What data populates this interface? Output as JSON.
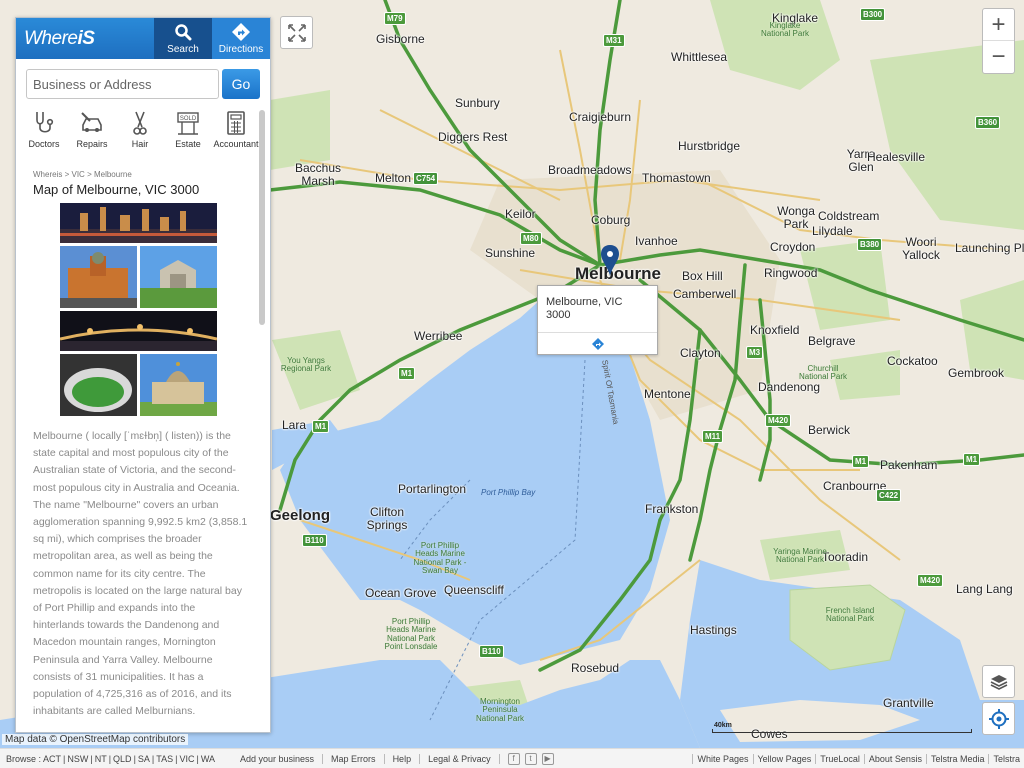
{
  "panel": {
    "logo_a": "Where",
    "logo_b": "iS",
    "search_tab": "Search",
    "directions_tab": "Directions",
    "search_placeholder": "Business or Address",
    "go_label": "Go",
    "categories": [
      {
        "label": "Doctors",
        "icon": "stethoscope-icon"
      },
      {
        "label": "Repairs",
        "icon": "car-repair-icon"
      },
      {
        "label": "Hair",
        "icon": "scissors-icon"
      },
      {
        "label": "Estate",
        "icon": "sold-sign-icon"
      },
      {
        "label": "Accountant",
        "icon": "calculator-icon"
      }
    ],
    "breadcrumb": [
      "Whereis",
      "VIC",
      "Melbourne"
    ],
    "breadcrumb_sep": ">",
    "page_title": "Map of Melbourne, VIC 3000",
    "description": "Melbourne ( locally [ˈmɛɫbn̩] ( listen)) is the state capital and most populous city of the Australian state of Victoria, and the second-most populous city in Australia and Oceania. The name \"Melbourne\" covers an urban agglomeration spanning 9,992.5 km2 (3,858.1 sq mi), which comprises the broader metropolitan area, as well as being the common name for its city centre. The metropolis is located on the large natural bay of Port Phillip and expands into the hinterlands towards the Dandenong and Macedon mountain ranges, Mornington Peninsula and Yarra Valley. Melbourne consists of 31 municipalities. It has a population of 4,725,316 as of 2016, and its inhabitants are called Melburnians."
  },
  "map": {
    "popup": "Melbourne, VIC 3000",
    "scale_label": "40km",
    "attribution": "Map data © OpenStreetMap contributors",
    "zoom_in": "+",
    "zoom_out": "−",
    "places": [
      {
        "name": "Gisborne",
        "cls": "town"
      },
      {
        "name": "Whittlesea",
        "cls": "town"
      },
      {
        "name": "Kinglake",
        "cls": "town"
      },
      {
        "name": "Sunbury",
        "cls": "town"
      },
      {
        "name": "Craigieburn",
        "cls": "town"
      },
      {
        "name": "Diggers Rest",
        "cls": "town"
      },
      {
        "name": "Hurstbridge",
        "cls": "town"
      },
      {
        "name": "Yarra Glen",
        "cls": "town"
      },
      {
        "name": "Healesville",
        "cls": "town"
      },
      {
        "name": "Bacchus Marsh",
        "cls": "town"
      },
      {
        "name": "Melton",
        "cls": "town"
      },
      {
        "name": "Broadmeadows",
        "cls": "town"
      },
      {
        "name": "Thomastown",
        "cls": "town"
      },
      {
        "name": "Keilor",
        "cls": "town"
      },
      {
        "name": "Coburg",
        "cls": "town"
      },
      {
        "name": "Wonga Park",
        "cls": "town"
      },
      {
        "name": "Coldstream",
        "cls": "town"
      },
      {
        "name": "Lilydale",
        "cls": "town"
      },
      {
        "name": "Ivanhoe",
        "cls": "town"
      },
      {
        "name": "Croydon",
        "cls": "town"
      },
      {
        "name": "Woori Yallock",
        "cls": "town"
      },
      {
        "name": "Launching Place",
        "cls": "town"
      },
      {
        "name": "Sunshine",
        "cls": "town"
      },
      {
        "name": "Melbourne",
        "cls": "city"
      },
      {
        "name": "Box Hill",
        "cls": "town"
      },
      {
        "name": "Ringwood",
        "cls": "town"
      },
      {
        "name": "Camberwell",
        "cls": "town"
      },
      {
        "name": "Knoxfield",
        "cls": "town"
      },
      {
        "name": "Werribee",
        "cls": "town"
      },
      {
        "name": "Belgrave",
        "cls": "town"
      },
      {
        "name": "Clayton",
        "cls": "town"
      },
      {
        "name": "Cockatoo",
        "cls": "town"
      },
      {
        "name": "Dandenong",
        "cls": "town"
      },
      {
        "name": "Gembrook",
        "cls": "town"
      },
      {
        "name": "Mentone",
        "cls": "town"
      },
      {
        "name": "Lara",
        "cls": "town"
      },
      {
        "name": "Berwick",
        "cls": "town"
      },
      {
        "name": "Pakenham",
        "cls": "town"
      },
      {
        "name": "Portarlington",
        "cls": "town"
      },
      {
        "name": "Cranbourne",
        "cls": "town"
      },
      {
        "name": "Geelong",
        "cls": "big"
      },
      {
        "name": "Clifton Springs",
        "cls": "town"
      },
      {
        "name": "Frankston",
        "cls": "town"
      },
      {
        "name": "Tooradin",
        "cls": "town"
      },
      {
        "name": "Ocean Grove",
        "cls": "town"
      },
      {
        "name": "Queenscliff",
        "cls": "town"
      },
      {
        "name": "Lang Lang",
        "cls": "town"
      },
      {
        "name": "Hastings",
        "cls": "town"
      },
      {
        "name": "Rosebud",
        "cls": "town"
      },
      {
        "name": "Grantville",
        "cls": "town"
      },
      {
        "name": "Cowes",
        "cls": "town"
      },
      {
        "name": "You Yangs Regional Park",
        "cls": "park"
      },
      {
        "name": "Churchill National Park",
        "cls": "park"
      },
      {
        "name": "Kinglake National Park",
        "cls": "park"
      },
      {
        "name": "Port Phillip Heads Marine National Park - Swan Bay",
        "cls": "park"
      },
      {
        "name": "Port Phillip Heads Marine National Park Point Lonsdale",
        "cls": "park"
      },
      {
        "name": "Yaringa Marine National Park",
        "cls": "park"
      },
      {
        "name": "French Island National Park",
        "cls": "park"
      },
      {
        "name": "Mornington Peninsula National Park",
        "cls": "park"
      },
      {
        "name": "Port Phillip Bay",
        "cls": "water"
      },
      {
        "name": "Spirit Of Tasmania",
        "cls": "route"
      }
    ],
    "shields": [
      "M79",
      "M31",
      "M80",
      "M1",
      "M3",
      "M1",
      "M1",
      "M420",
      "M11",
      "C754",
      "B300",
      "B360",
      "B380",
      "B110",
      "B110",
      "M1",
      "C422",
      "M420"
    ]
  },
  "footer": {
    "browse_label": "Browse :",
    "states": [
      "ACT",
      "NSW",
      "NT",
      "QLD",
      "SA",
      "TAS",
      "VIC",
      "WA"
    ],
    "links": [
      "Add your business",
      "Map Errors",
      "Help",
      "Legal & Privacy"
    ],
    "social": [
      "f",
      "t",
      "▶"
    ],
    "sensis": [
      "White Pages",
      "Yellow Pages",
      "TrueLocal",
      "About Sensis",
      "Telstra Media",
      "Telstra"
    ]
  },
  "colors": {
    "brand_blue": "#1e6fc0",
    "water": "#a9cdf5",
    "land": "#efeae0",
    "park": "#cfe3b5",
    "motorway": "#4c9a3c",
    "arterial": "#e8c77a"
  }
}
